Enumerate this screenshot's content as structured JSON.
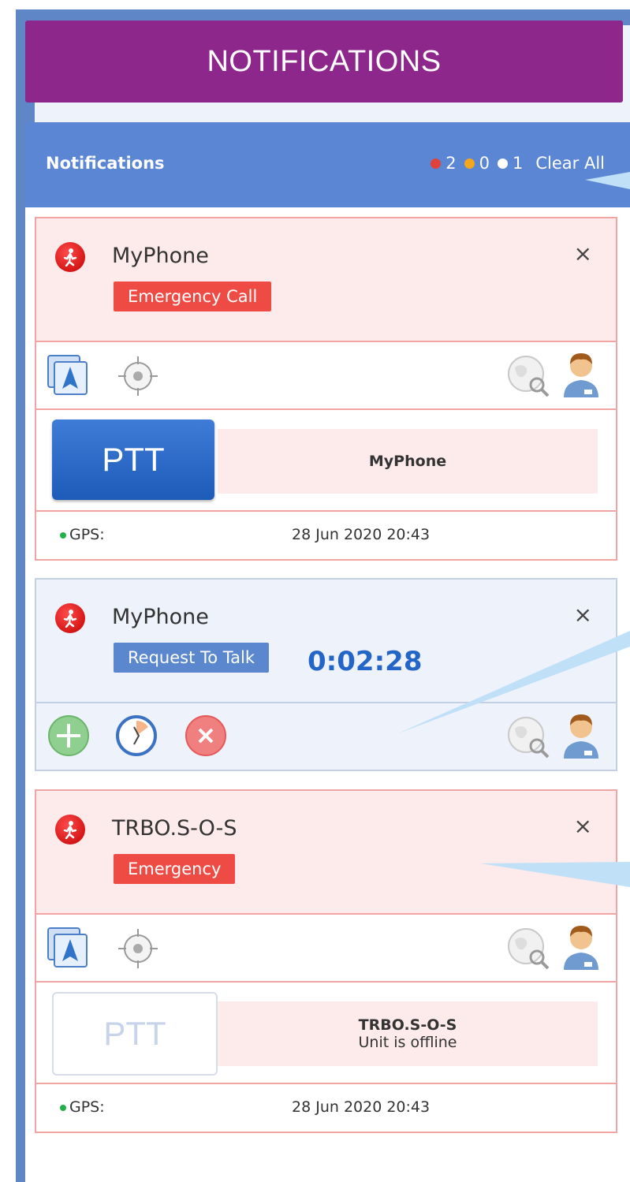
{
  "header": {
    "title": "NOTIFICATIONS"
  },
  "subheader": {
    "label": "Notifications",
    "counts": [
      {
        "value": "2",
        "color": "#e0413b"
      },
      {
        "value": "0",
        "color": "#f2a71e"
      },
      {
        "value": "1",
        "color": "#ffffff"
      }
    ],
    "clear_all": "Clear All"
  },
  "cards": [
    {
      "name": "MyPhone",
      "badge": "Emergency Call",
      "ptt_label": "PTT",
      "ptt_name": "MyPhone",
      "ptt_status": "",
      "gps_label": "GPS:",
      "gps_time": "28 Jun 2020 20:43"
    },
    {
      "name": "MyPhone",
      "badge": "Request To Talk",
      "timer": "0:02:28"
    },
    {
      "name": "TRBO.S-O-S",
      "badge": "Emergency",
      "ptt_label": "PTT",
      "ptt_name": "TRBO.S-O-S",
      "ptt_status": "Unit is offline",
      "gps_label": "GPS:",
      "gps_time": "28 Jun 2020 20:43"
    }
  ],
  "icons": {
    "close": "×",
    "run": "🏃"
  }
}
